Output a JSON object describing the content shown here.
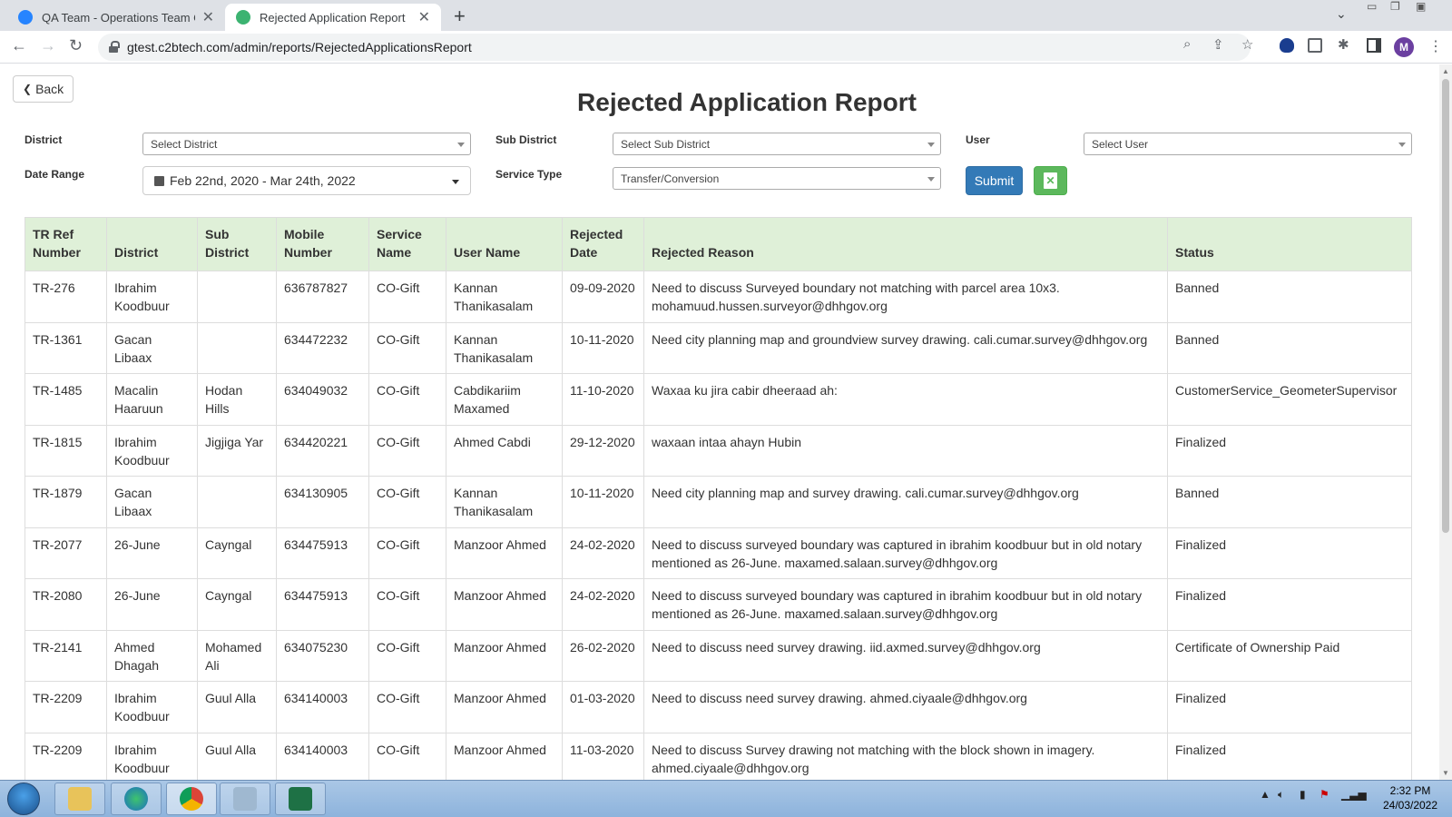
{
  "browser": {
    "tabs": [
      {
        "title": "QA Team - Operations Team Coll",
        "active": false
      },
      {
        "title": "Rejected Application Report",
        "active": true
      }
    ],
    "url": "gtest.c2btech.com/admin/reports/RejectedApplicationsReport",
    "profile_initial": "M"
  },
  "page": {
    "back_label": "Back",
    "title": "Rejected Application Report",
    "filters": {
      "district_label": "District",
      "district_value": "Select District",
      "subdistrict_label": "Sub District",
      "subdistrict_value": "Select Sub District",
      "user_label": "User",
      "user_value": "Select User",
      "daterange_label": "Date Range",
      "daterange_value": "Feb 22nd, 2020 - Mar 24th, 2022",
      "servicetype_label": "Service Type",
      "servicetype_value": "Transfer/Conversion",
      "submit_label": "Submit"
    },
    "table": {
      "headers": [
        "TR Ref Number",
        "District",
        "Sub District",
        "Mobile Number",
        "Service Name",
        "User Name",
        "Rejected Date",
        "Rejected Reason",
        "Status"
      ],
      "rows": [
        [
          "TR-276",
          "Ibrahim Koodbuur",
          "",
          "636787827",
          "CO-Gift",
          "Kannan Thanikasalam",
          "09-09-2020",
          "Need to discuss Surveyed boundary not matching with parcel area 10x3. mohamuud.hussen.surveyor@dhhgov.org",
          "Banned"
        ],
        [
          "TR-1361",
          "Gacan Libaax",
          "",
          "634472232",
          "CO-Gift",
          "Kannan Thanikasalam",
          "10-11-2020",
          "Need city planning map and groundview survey drawing. cali.cumar.survey@dhhgov.org",
          "Banned"
        ],
        [
          "TR-1485",
          "Macalin Haaruun",
          "Hodan Hills",
          "634049032",
          "CO-Gift",
          "Cabdikariim Maxamed",
          "11-10-2020",
          "Waxaa ku jira cabir dheeraad ah:",
          "CustomerService_GeometerSupervisor"
        ],
        [
          "TR-1815",
          "Ibrahim Koodbuur",
          "Jigjiga Yar",
          "634420221",
          "CO-Gift",
          "Ahmed Cabdi",
          "29-12-2020",
          "waxaan intaa ahayn Hubin",
          "Finalized"
        ],
        [
          "TR-1879",
          "Gacan Libaax",
          "",
          "634130905",
          "CO-Gift",
          "Kannan Thanikasalam",
          "10-11-2020",
          "Need city planning map and survey drawing. cali.cumar.survey@dhhgov.org",
          "Banned"
        ],
        [
          "TR-2077",
          "26-June",
          "Cayngal",
          "634475913",
          "CO-Gift",
          "Manzoor Ahmed",
          "24-02-2020",
          "Need to discuss surveyed boundary was captured in ibrahim koodbuur but in old notary mentioned as 26-June. maxamed.salaan.survey@dhhgov.org",
          "Finalized"
        ],
        [
          "TR-2080",
          "26-June",
          "Cayngal",
          "634475913",
          "CO-Gift",
          "Manzoor Ahmed",
          "24-02-2020",
          "Need to discuss surveyed boundary was captured in ibrahim koodbuur but in old notary mentioned as 26-June. maxamed.salaan.survey@dhhgov.org",
          "Finalized"
        ],
        [
          "TR-2141",
          "Ahmed Dhagah",
          "Mohamed Ali",
          "634075230",
          "CO-Gift",
          "Manzoor Ahmed",
          "26-02-2020",
          "Need to discuss need survey drawing. iid.axmed.survey@dhhgov.org",
          "Certificate of Ownership Paid"
        ],
        [
          "TR-2209",
          "Ibrahim Koodbuur",
          "Guul Alla",
          "634140003",
          "CO-Gift",
          "Manzoor Ahmed",
          "01-03-2020",
          "Need to discuss need survey drawing. ahmed.ciyaale@dhhgov.org",
          "Finalized"
        ],
        [
          "TR-2209",
          "Ibrahim Koodbuur",
          "Guul Alla",
          "634140003",
          "CO-Gift",
          "Manzoor Ahmed",
          "11-03-2020",
          "Need to discuss Survey drawing not matching with the block shown in imagery. ahmed.ciyaale@dhhgov.org",
          "Finalized"
        ]
      ]
    }
  },
  "taskbar": {
    "time": "2:32 PM",
    "date": "24/03/2022"
  },
  "colors": {
    "table_header_bg": "#dff0d8",
    "submit_bg": "#337ab7",
    "excel_bg": "#5cb85c"
  }
}
